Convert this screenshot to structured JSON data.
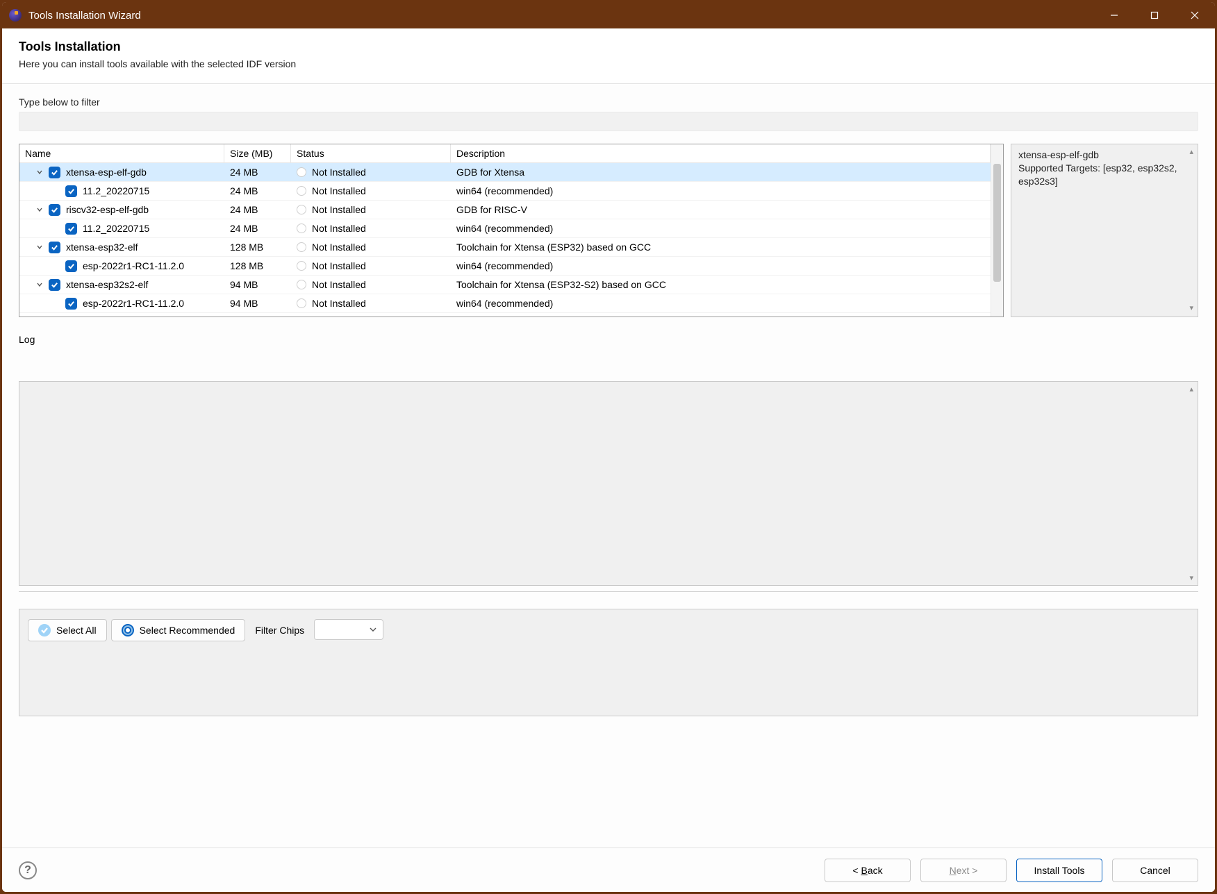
{
  "window": {
    "title": "Tools Installation Wizard"
  },
  "header": {
    "title": "Tools Installation",
    "subtitle": "Here you can install tools available with the selected IDF version"
  },
  "filter": {
    "label": "Type below to filter",
    "value": ""
  },
  "columns": {
    "name": "Name",
    "size": "Size (MB)",
    "status": "Status",
    "description": "Description"
  },
  "rows": [
    {
      "level": 0,
      "expanded": true,
      "checked": true,
      "name": "xtensa-esp-elf-gdb",
      "size": "24 MB",
      "status": "Not Installed",
      "description": "GDB for Xtensa",
      "selected": true
    },
    {
      "level": 1,
      "expanded": null,
      "checked": true,
      "name": "11.2_20220715",
      "size": "24 MB",
      "status": "Not Installed",
      "description": "win64 (recommended)"
    },
    {
      "level": 0,
      "expanded": true,
      "checked": true,
      "name": "riscv32-esp-elf-gdb",
      "size": "24 MB",
      "status": "Not Installed",
      "description": "GDB for RISC-V"
    },
    {
      "level": 1,
      "expanded": null,
      "checked": true,
      "name": "11.2_20220715",
      "size": "24 MB",
      "status": "Not Installed",
      "description": "win64 (recommended)"
    },
    {
      "level": 0,
      "expanded": true,
      "checked": true,
      "name": "xtensa-esp32-elf",
      "size": "128 MB",
      "status": "Not Installed",
      "description": "Toolchain for Xtensa (ESP32) based on GCC"
    },
    {
      "level": 1,
      "expanded": null,
      "checked": true,
      "name": "esp-2022r1-RC1-11.2.0",
      "size": "128 MB",
      "status": "Not Installed",
      "description": "win64 (recommended)"
    },
    {
      "level": 0,
      "expanded": true,
      "checked": true,
      "name": "xtensa-esp32s2-elf",
      "size": "94 MB",
      "status": "Not Installed",
      "description": "Toolchain for Xtensa (ESP32-S2) based on GCC"
    },
    {
      "level": 1,
      "expanded": null,
      "checked": true,
      "name": "esp-2022r1-RC1-11.2.0",
      "size": "94 MB",
      "status": "Not Installed",
      "description": "win64 (recommended)"
    }
  ],
  "side": {
    "line1": "xtensa-esp-elf-gdb",
    "line2": "Supported Targets: [esp32, esp32s2, esp32s3]"
  },
  "log": {
    "label": "Log"
  },
  "controls": {
    "select_all": "Select All",
    "select_recommended": "Select Recommended",
    "filter_chips_label": "Filter Chips"
  },
  "footer": {
    "back": "Back",
    "next": "Next >",
    "install": "Install Tools",
    "cancel": "Cancel"
  }
}
